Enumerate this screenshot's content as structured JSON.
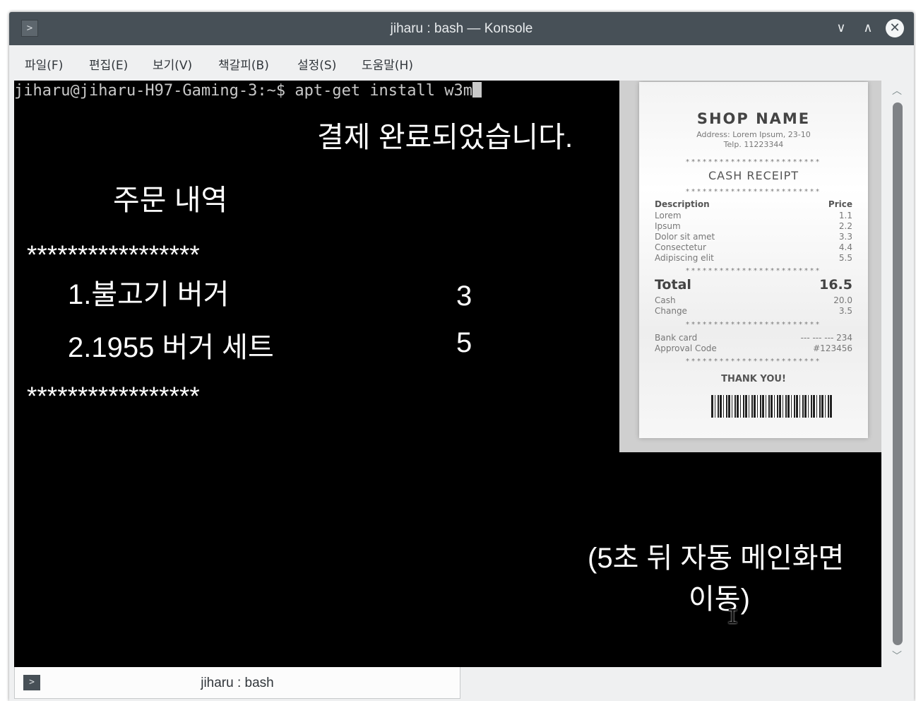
{
  "window": {
    "title": "jiharu : bash — Konsole",
    "app_icon_glyph": ">",
    "controls": {
      "minimize": "∨",
      "maximize": "∧",
      "close": "✕"
    }
  },
  "menubar": {
    "items": [
      "파일(F)",
      "편집(E)",
      "보기(V)",
      "책갈피(B)",
      "설정(S)",
      "도움말(H)"
    ]
  },
  "terminal": {
    "prompt_line": "jiharu@jiharu-H97-Gaming-3:~$ apt-get install w3m",
    "overlay": {
      "payment_complete": "결제 완료되었습니다.",
      "order_title": "주문 내역",
      "separator_top": "*****************",
      "items": [
        {
          "name": "1.불고기 버거",
          "qty": "3"
        },
        {
          "name": "2.1955 버거 세트",
          "qty": "5"
        }
      ],
      "separator_bottom": "*****************",
      "auto_redirect_line1": "(5초 뒤 자동 메인화면",
      "auto_redirect_line2": "이동)"
    },
    "receipt": {
      "shop_name": "SHOP NAME",
      "address": "Address: Lorem Ipsum, 23-10",
      "telp": "Telp. 11223344",
      "stars": "************************",
      "heading": "CASH RECEIPT",
      "col_description": "Description",
      "col_price": "Price",
      "lines": [
        {
          "desc": "Lorem",
          "price": "1.1"
        },
        {
          "desc": "Ipsum",
          "price": "2.2"
        },
        {
          "desc": "Dolor sit amet",
          "price": "3.3"
        },
        {
          "desc": "Consectetur",
          "price": "4.4"
        },
        {
          "desc": "Adipiscing elit",
          "price": "5.5"
        }
      ],
      "total_label": "Total",
      "total_value": "16.5",
      "cash_label": "Cash",
      "cash_value": "20.0",
      "change_label": "Change",
      "change_value": "3.5",
      "bank_label": "Bank card",
      "bank_value": "--- --- --- 234",
      "approval_label": "Approval Code",
      "approval_value": "#123456",
      "thanks": "THANK YOU!"
    }
  },
  "scrollbar": {
    "up": "︿",
    "down": "﹀"
  },
  "tabbar": {
    "tab_label": "jiharu : bash",
    "tab_icon_glyph": ">"
  },
  "cursor": {
    "glyph": "I"
  },
  "colors": {
    "titlebar": "#475057",
    "terminal_bg": "#000000",
    "terminal_fg": "#c8c8c8",
    "chrome": "#eff0f1"
  }
}
